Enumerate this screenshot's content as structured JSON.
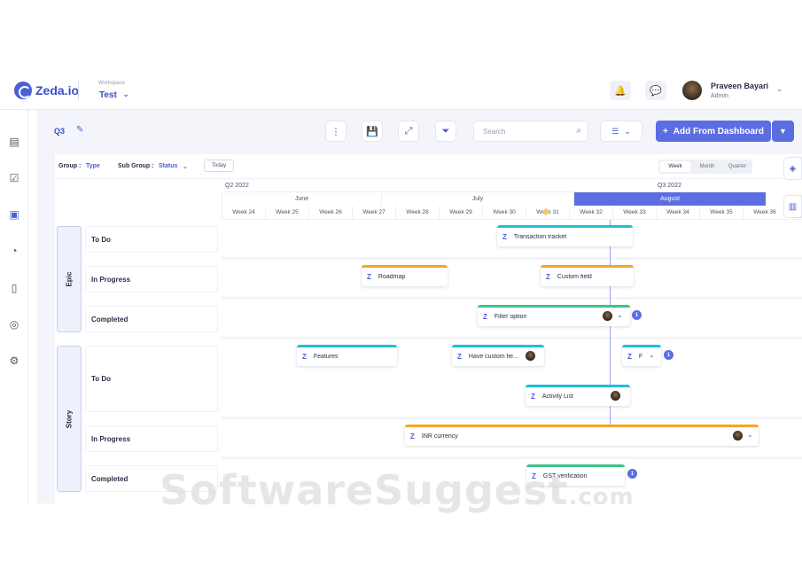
{
  "brand": {
    "name": "Zeda.io"
  },
  "workspace": {
    "label": "Workspace",
    "value": "Test"
  },
  "user": {
    "name": "Praveen Bayari",
    "role": "Admin"
  },
  "icons": {
    "notification": "bell-icon",
    "feedback": "feedback-icon"
  },
  "sidebar": {
    "items": [
      "inbox-icon",
      "checklist-icon",
      "roadmap-icon",
      "insights-icon",
      "document-icon",
      "support-icon",
      "settings-icon"
    ]
  },
  "toolbar": {
    "period": "Q3",
    "search_placeholder": "Search",
    "add_label": "Add From Dashboard",
    "add_icon": "+"
  },
  "filters": {
    "group_label": "Group :",
    "group_value": "Type",
    "subgroup_label": "Sub Group :",
    "subgroup_value": "Status",
    "today_label": "Today",
    "scales": [
      "Week",
      "Month",
      "Quarter"
    ],
    "active_scale": "Week"
  },
  "timeline": {
    "quarters": [
      "Q2 2022",
      "Q3 2022"
    ],
    "months": [
      "June",
      "July",
      "August"
    ],
    "weeks": [
      "Week 24",
      "Week 25",
      "Week 26",
      "Week 27",
      "Week 28",
      "Week 29",
      "Week 30",
      "Week 31",
      "Week 32",
      "Week 33",
      "Week 34",
      "Week 35",
      "Week 36"
    ]
  },
  "groups": [
    {
      "name": "Epic",
      "lanes": [
        "To Do",
        "In Progress",
        "Completed"
      ]
    },
    {
      "name": "Story",
      "lanes": [
        "To Do",
        "In Progress",
        "Completed"
      ]
    }
  ],
  "cards": [
    {
      "title": "Transaction tracket",
      "color": "#1ec0d9",
      "icon": "Z"
    },
    {
      "title": "Roadmap",
      "color": "#f5a623",
      "icon": "Z"
    },
    {
      "title": "Custom field",
      "color": "#f5a623",
      "icon": "Z"
    },
    {
      "title": "Filter option",
      "color": "#3cc48a",
      "icon": "Z",
      "badge": "1"
    },
    {
      "title": "Features",
      "color": "#1ec0d9",
      "icon": "Z"
    },
    {
      "title": "Have custom fie...",
      "color": "#1ec0d9",
      "icon": "Z"
    },
    {
      "title": "F",
      "color": "#1ec0d9",
      "icon": "Z",
      "badge": "1"
    },
    {
      "title": "Activity List",
      "color": "#1ec0d9",
      "icon": "Z"
    },
    {
      "title": "INR currency",
      "color": "#f5a623",
      "icon": "Z"
    },
    {
      "title": "GST verification",
      "color": "#3cc48a",
      "icon": "Z",
      "badge": "1"
    }
  ],
  "watermark": {
    "main": "SoftwareSuggest",
    "suffix": ".com"
  }
}
